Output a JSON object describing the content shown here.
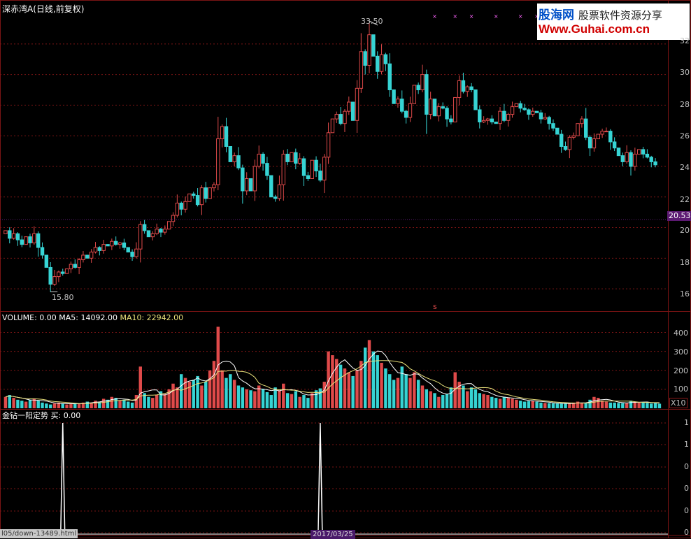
{
  "header": {
    "stock_name": "深赤湾A",
    "mode": "(日线,前复权)"
  },
  "watermark": {
    "line1_brand": "股海网",
    "line1_slogan": "股票软件资源分享",
    "line2": "Www.Guhai.com.cn"
  },
  "price_panel": {
    "high_label": "33.50",
    "low_label": "15.80",
    "last_price_tag": "20.53",
    "marker": "s",
    "axis_ticks": [
      "32",
      "30",
      "28",
      "26",
      "24",
      "22",
      "20",
      "18",
      "16"
    ]
  },
  "volume_panel": {
    "label_volume": "VOLUME: 0.00",
    "label_ma5": "MA5: 14092.00",
    "label_ma10": "MA10: 22942.00",
    "axis_ticks": [
      "400",
      "300",
      "200",
      "100"
    ],
    "unit_tag": "X10"
  },
  "indicator_panel": {
    "label": "金钻一阳定势 买: 0.00",
    "axis_ticks": [
      "1",
      "1",
      "0",
      "0",
      "0",
      "0"
    ]
  },
  "footer": {
    "status_url": "l05/down-13489.html",
    "date_label": "2017/03/25"
  },
  "colors": {
    "up": "#e04a4a",
    "down": "#36d4d4",
    "ma5": "#ffffff",
    "ma10": "#e8e07a",
    "grid": "#7a1414",
    "signal_x": "#ff66ff"
  },
  "chart_data": {
    "type": "candlestick",
    "price": {
      "ylim": [
        15,
        33.5
      ],
      "high": 33.5,
      "low": 15.8,
      "closes": [
        19.8,
        19.3,
        19.6,
        19.2,
        18.9,
        19.4,
        19.0,
        19.6,
        18.7,
        18.2,
        17.4,
        16.3,
        16.8,
        17.1,
        17.0,
        17.3,
        17.6,
        17.4,
        17.9,
        18.2,
        18.0,
        18.4,
        18.7,
        18.5,
        18.9,
        18.8,
        19.1,
        18.9,
        19.0,
        18.7,
        18.4,
        18.1,
        18.6,
        20.2,
        19.8,
        19.4,
        19.6,
        19.9,
        19.7,
        19.9,
        20.4,
        20.8,
        21.6,
        21.2,
        21.7,
        22.2,
        22.1,
        21.5,
        22.6,
        21.9,
        22.6,
        22.8,
        25.8,
        26.6,
        25.3,
        24.3,
        24.7,
        23.9,
        22.4,
        23.2,
        22.4,
        24.0,
        24.8,
        24.2,
        23.4,
        22.0,
        21.9,
        22.8,
        24.8,
        24.3,
        24.9,
        24.2,
        24.5,
        23.4,
        23.2,
        24.4,
        23.7,
        23.1,
        24.6,
        26.2,
        27.1,
        27.4,
        26.8,
        27.6,
        28.2,
        27.0,
        29.1,
        31.5,
        30.6,
        32.6,
        31.2,
        30.2,
        31.3,
        30.7,
        29.0,
        28.1,
        28.4,
        27.6,
        27.2,
        28.1,
        29.3,
        29.0,
        30.0,
        27.4,
        28.4,
        27.3,
        27.9,
        27.8,
        27.1,
        26.9,
        28.5,
        29.6,
        28.9,
        29.2,
        29.0,
        27.7,
        26.9,
        27.0,
        27.1,
        26.9,
        26.8,
        27.6,
        27.0,
        27.4,
        27.9,
        28.1,
        27.8,
        27.7,
        27.4,
        27.6,
        27.5,
        27.1,
        27.2,
        26.8,
        26.5,
        26.1,
        25.3,
        25.1,
        25.9,
        26.0,
        26.8,
        27.1,
        25.9,
        25.2,
        25.8,
        26.1,
        26.3,
        26.3,
        25.6,
        25.2,
        24.7,
        24.3,
        24.9,
        24.0,
        24.8,
        25.1,
        24.8,
        24.6,
        24.3,
        24.1
      ]
    },
    "volume": {
      "ylim": [
        0,
        450
      ],
      "ma5": 14092.0,
      "ma10": 22942.0,
      "values": [
        60,
        70,
        55,
        45,
        40,
        35,
        45,
        50,
        40,
        30,
        25,
        20,
        25,
        30,
        25,
        20,
        22,
        28,
        25,
        30,
        35,
        28,
        40,
        35,
        50,
        45,
        60,
        55,
        40,
        45,
        35,
        30,
        70,
        220,
        80,
        60,
        55,
        70,
        90,
        75,
        100,
        130,
        110,
        180,
        160,
        140,
        150,
        170,
        120,
        140,
        200,
        250,
        430,
        200,
        160,
        180,
        150,
        120,
        110,
        100,
        95,
        90,
        120,
        100,
        85,
        70,
        110,
        95,
        130,
        80,
        75,
        90,
        60,
        70,
        55,
        80,
        95,
        105,
        140,
        300,
        280,
        260,
        230,
        210,
        190,
        170,
        200,
        250,
        320,
        360,
        300,
        280,
        240,
        210,
        180,
        150,
        160,
        220,
        180,
        160,
        190,
        150,
        120,
        100,
        90,
        80,
        60,
        70,
        75,
        110,
        190,
        140,
        120,
        90,
        110,
        100,
        80,
        75,
        70,
        60,
        55,
        50,
        60,
        55,
        50,
        45,
        40,
        35,
        38,
        40,
        35,
        30,
        28,
        27,
        26,
        25,
        24,
        26,
        25,
        30,
        35,
        28,
        27,
        45,
        60,
        55,
        40,
        35,
        30,
        30,
        28,
        27,
        26,
        40,
        35,
        30,
        33,
        28,
        25,
        27,
        24
      ]
    },
    "indicator": {
      "ylim": [
        0,
        1
      ],
      "signals": [
        0,
        0,
        0,
        0,
        0,
        0,
        0,
        0,
        0,
        0,
        0,
        0,
        0,
        0,
        0,
        0,
        0,
        0,
        0,
        0,
        0,
        0,
        0,
        0,
        0,
        0,
        0,
        0,
        0,
        0,
        0,
        0,
        0,
        0,
        0,
        0,
        0,
        0,
        0,
        0,
        0,
        0,
        0,
        0,
        0,
        0,
        0,
        0,
        0,
        0,
        0,
        0,
        0,
        0,
        0,
        0,
        0,
        0,
        0,
        0,
        0,
        0,
        0,
        0,
        0,
        0,
        0,
        0,
        0,
        0,
        0,
        0,
        0,
        0,
        0,
        0,
        0,
        0,
        0,
        0,
        0,
        0,
        0,
        0,
        0,
        0,
        0,
        0,
        0,
        0,
        0,
        0,
        0,
        0,
        0,
        0,
        0,
        0,
        0,
        0,
        0,
        0,
        0,
        0,
        0,
        0,
        0,
        0,
        0,
        0,
        0,
        0,
        0,
        0,
        0,
        0,
        0,
        0,
        0,
        0,
        0,
        0,
        0,
        0,
        0,
        0,
        0,
        0,
        0,
        0,
        0,
        0,
        0,
        0,
        0,
        0,
        0,
        0,
        0,
        0,
        0,
        0,
        0,
        0,
        0,
        0,
        0,
        0,
        0,
        0,
        0,
        0,
        0,
        0,
        0,
        0,
        0,
        0,
        0,
        0,
        0,
        0,
        0,
        0
      ],
      "signal_bars": [
        14,
        77
      ]
    }
  }
}
